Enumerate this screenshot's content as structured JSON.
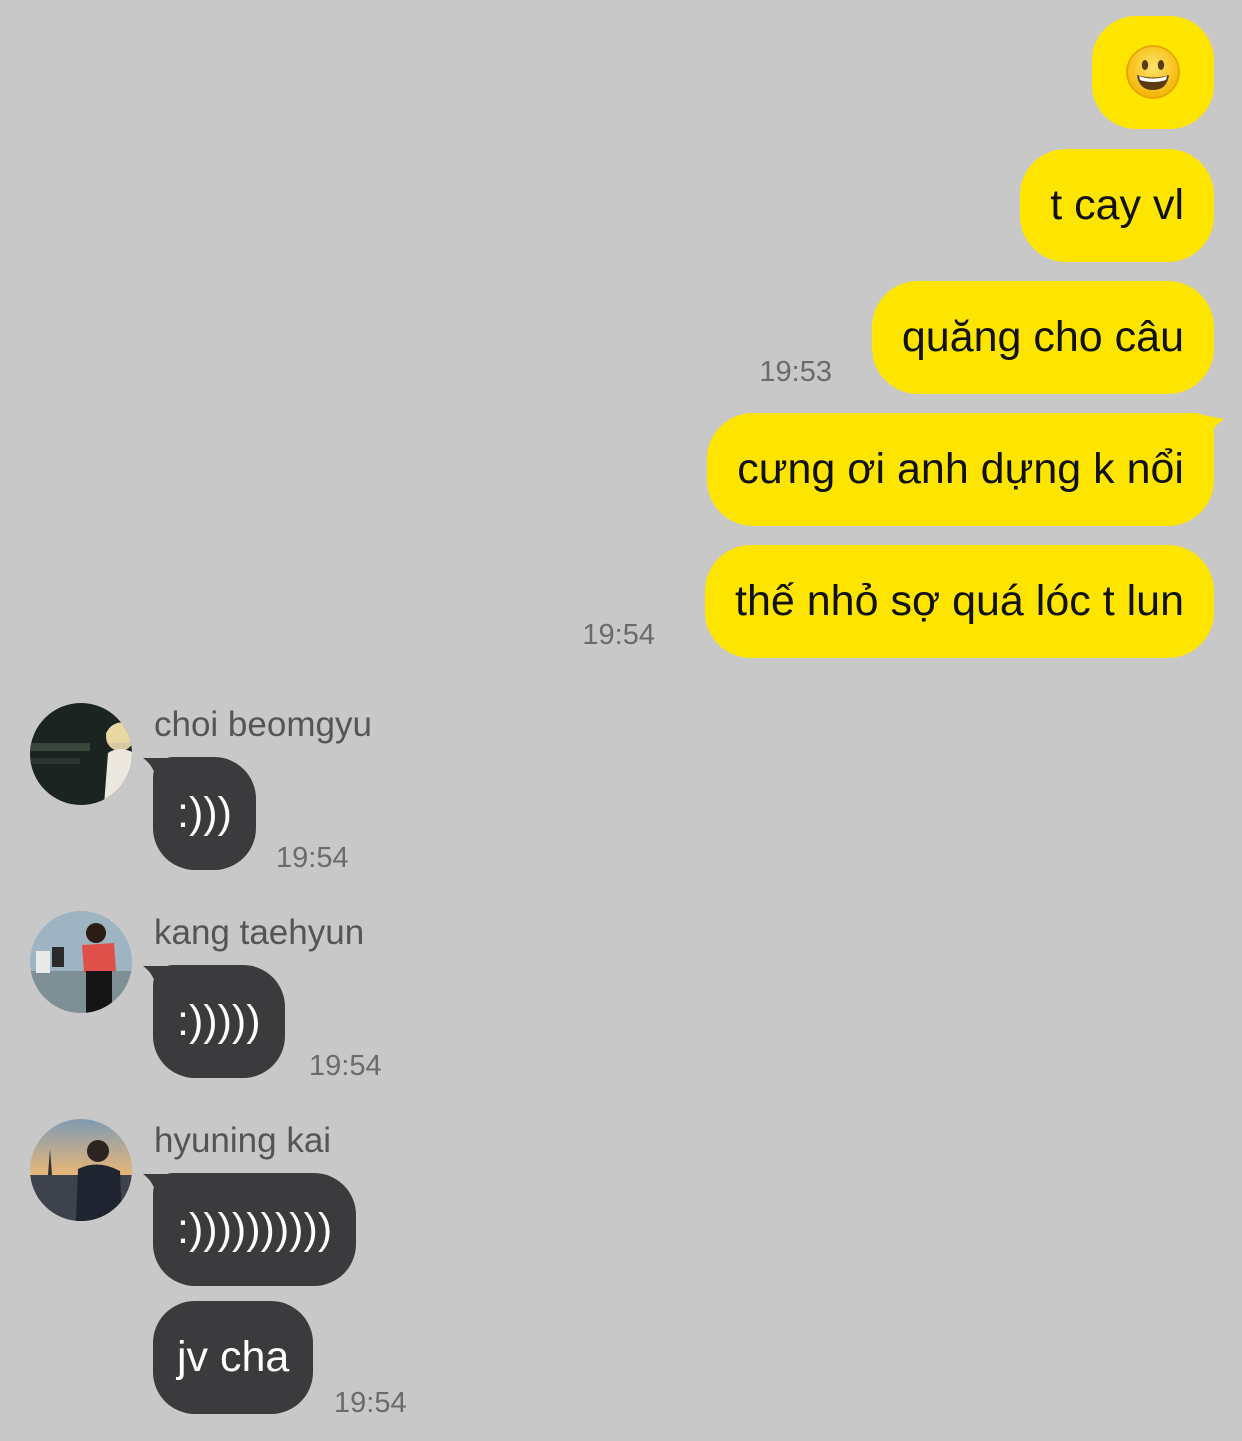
{
  "outgoing": [
    {
      "text": "😀",
      "time": ""
    },
    {
      "text": "t cay vl",
      "time": ""
    },
    {
      "text": "quăng cho câu",
      "time": "19:53"
    },
    {
      "text": "cưng ơi anh dựng k nổi",
      "time": ""
    },
    {
      "text": "thế nhỏ sợ quá lóc t lun",
      "time": "19:54"
    }
  ],
  "incoming": [
    {
      "sender": "choi beomgyu",
      "avatar_icon": "profile-photo",
      "messages": [
        ":)))"
      ],
      "time": "19:54"
    },
    {
      "sender": "kang taehyun",
      "avatar_icon": "profile-photo",
      "messages": [
        ":)))))"
      ],
      "time": "19:54"
    },
    {
      "sender": "hyuning kai",
      "avatar_icon": "profile-photo",
      "messages": [
        ":))))))))))",
        "jv cha"
      ],
      "time": "19:54"
    }
  ],
  "colors": {
    "background": "#c8c8c8",
    "outgoing_bubble": "#fee500",
    "incoming_bubble": "#3b3b3d",
    "timestamp": "#6b6b6b"
  }
}
